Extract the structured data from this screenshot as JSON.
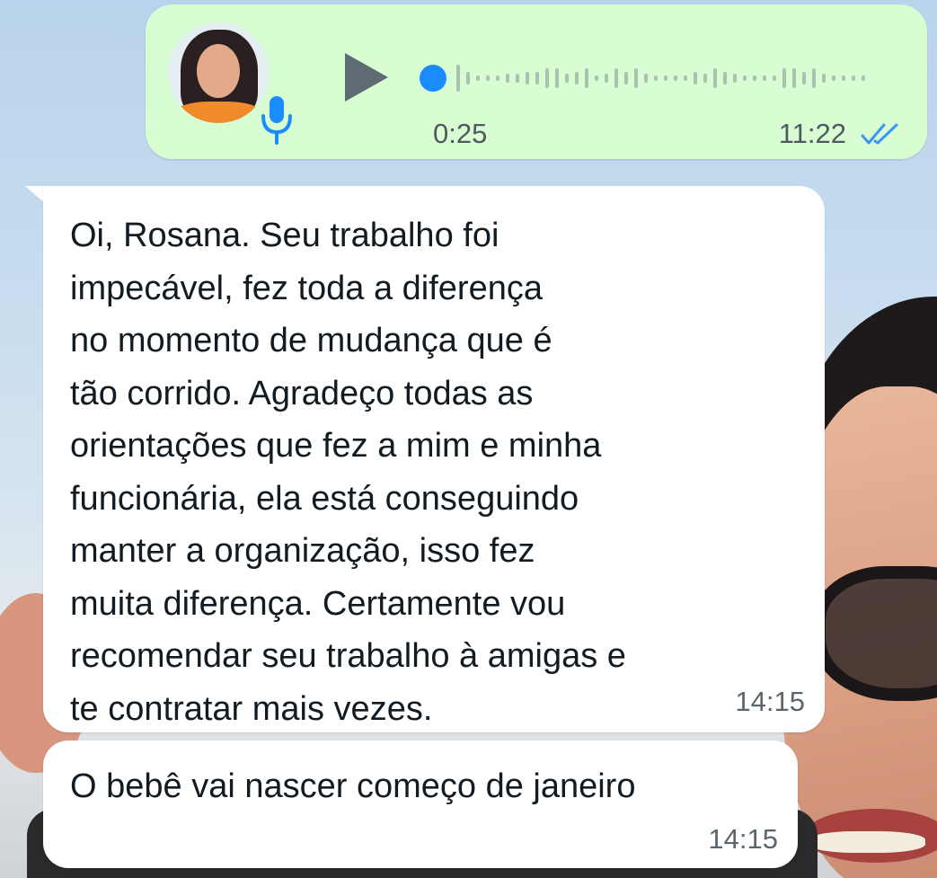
{
  "voice_message": {
    "duration": "0:25",
    "time": "11:22",
    "status": "read",
    "colors": {
      "bubble": "#d9fdd3",
      "accent": "#1a8cff",
      "ticks": "#3b96f5"
    },
    "icons": {
      "play": "play-icon",
      "mic": "microphone-icon",
      "status": "double-check-icon"
    }
  },
  "messages": [
    {
      "text": "Oi, Rosana. Seu trabalho foi\nimpecável, fez toda a diferença\nno momento de mudança que é\ntão corrido. Agradeço todas as\norientações que fez a mim e minha\nfuncionária, ela está conseguindo\nmanter a organização, isso fez\nmuita diferença. Certamente vou\nrecomendar seu trabalho à amigas e\nte contratar mais vezes.",
      "time": "14:15"
    },
    {
      "text": "O bebê vai nascer começo de janeiro",
      "time": "14:15"
    }
  ]
}
